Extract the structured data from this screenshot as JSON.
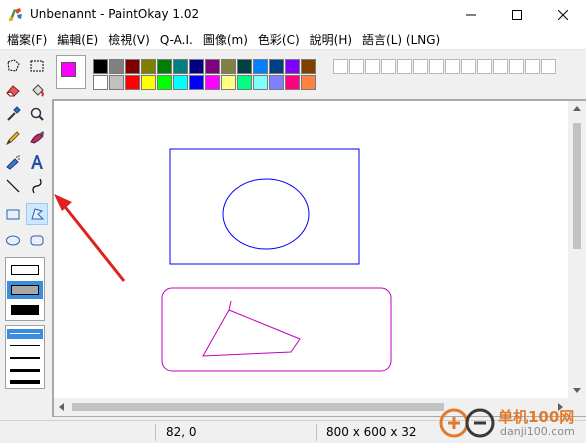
{
  "window": {
    "title": "Unbenannt - PaintOkay 1.02"
  },
  "menu": {
    "items": [
      "檔案(F)",
      "編輯(E)",
      "檢視(V)",
      "Q-A.I.",
      "圖像(m)",
      "色彩(C)",
      "說明(H)",
      "語言(L) (LNG)"
    ]
  },
  "colors": {
    "foreground": "#ff00ff",
    "palette_row1": [
      "#000000",
      "#808080",
      "#800000",
      "#808000",
      "#008000",
      "#008080",
      "#000080",
      "#800080",
      "#808040",
      "#004040",
      "#0080ff",
      "#004080",
      "#8000ff",
      "#804000"
    ],
    "palette_row2": [
      "#ffffff",
      "#c0c0c0",
      "#ff0000",
      "#ffff00",
      "#00ff00",
      "#00ffff",
      "#0000ff",
      "#ff00ff",
      "#ffff80",
      "#00ff80",
      "#80ffff",
      "#8080ff",
      "#ff0080",
      "#ff8040"
    ],
    "empty_slots": 14
  },
  "tools": [
    {
      "name": "free-select-icon"
    },
    {
      "name": "rect-select-icon"
    },
    {
      "name": "eraser-icon"
    },
    {
      "name": "fill-bucket-icon"
    },
    {
      "name": "color-picker-icon"
    },
    {
      "name": "magnifier-icon"
    },
    {
      "name": "pencil-icon"
    },
    {
      "name": "brush-icon"
    },
    {
      "name": "airbrush-icon"
    },
    {
      "name": "text-tool-icon"
    },
    {
      "name": "line-tool-icon"
    },
    {
      "name": "curve-tool-icon"
    },
    {
      "name": "rectangle-tool-icon"
    },
    {
      "name": "polygon-tool-icon"
    },
    {
      "name": "ellipse-tool-icon"
    },
    {
      "name": "rounded-rect-tool-icon"
    }
  ],
  "status": {
    "coordinates": "82, 0",
    "image_info": "800 x 600 x 32"
  },
  "watermark": {
    "title": "单机100网",
    "url": "danji100.com"
  }
}
